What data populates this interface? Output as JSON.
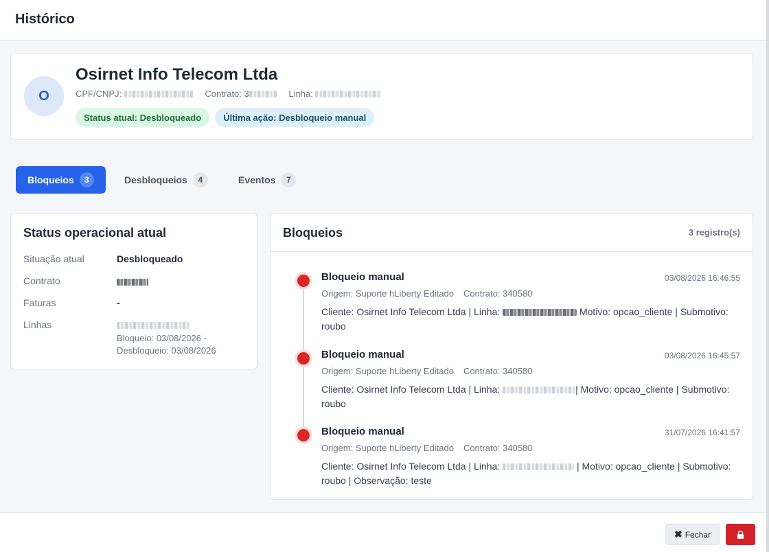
{
  "modal": {
    "title": "Histórico"
  },
  "client": {
    "avatar_initial": "O",
    "name": "Osirnet Info Telecom Ltda",
    "cpf_label": "CPF/CNPJ:",
    "contract_label": "Contrato:",
    "contract_partial": "3",
    "line_label": "Linha:",
    "status_badge": "Status atual: Desbloqueado",
    "last_action_badge": "Última ação: Desbloqueio manual"
  },
  "tabs": [
    {
      "label": "Bloqueios",
      "count": "3",
      "active": true
    },
    {
      "label": "Desbloqueios",
      "count": "4",
      "active": false
    },
    {
      "label": "Eventos",
      "count": "7",
      "active": false
    }
  ],
  "status_panel": {
    "title": "Status operacional atual",
    "situacao_label": "Situação atual",
    "situacao_value": "Desbloqueado",
    "contrato_label": "Contrato",
    "faturas_label": "Faturas",
    "faturas_value": "-",
    "linhas_label": "Linhas",
    "linha_bloqueio": "Bloqueio: 03/08/2026 -",
    "linha_desbloqueio": "Desbloqueio: 03/08/2026"
  },
  "list": {
    "title": "Bloqueios",
    "count_text": "3 registro(s)",
    "items": [
      {
        "title": "Bloqueio manual",
        "date": "03/08/2026 16:46:55",
        "origin": "Origem: Suporte hLiberty Editado",
        "contract": "Contrato: 340580",
        "desc_prefix": "Cliente: Osirnet Info Telecom Ltda | Linha: ",
        "desc_suffix": " Motivo: opcao_cliente | Submotivo: roubo"
      },
      {
        "title": "Bloqueio manual",
        "date": "03/08/2026 16:45:57",
        "origin": "Origem: Suporte hLiberty Editado",
        "contract": "Contrato: 340580",
        "desc_prefix": "Cliente: Osirnet Info Telecom Ltda | Linha: ",
        "desc_suffix": "| Motivo: opcao_cliente | Submotivo: roubo"
      },
      {
        "title": "Bloqueio manual",
        "date": "31/07/2026 16:41:57",
        "origin": "Origem: Suporte hLiberty Editado",
        "contract": "Contrato: 340580",
        "desc_prefix": "Cliente: Osirnet Info Telecom Ltda | Linha: ",
        "desc_suffix": " | Motivo: opcao_cliente | Submotivo: roubo | Observação: teste"
      }
    ]
  },
  "footer": {
    "close_label": "Fechar",
    "close_icon": "x-icon",
    "lock_icon": "lock-icon",
    "danger_color": "#d4212a"
  },
  "colors": {
    "primary": "#2563eb",
    "status_green_bg": "#d9f7e3",
    "action_blue_bg": "#dcf0fb"
  }
}
